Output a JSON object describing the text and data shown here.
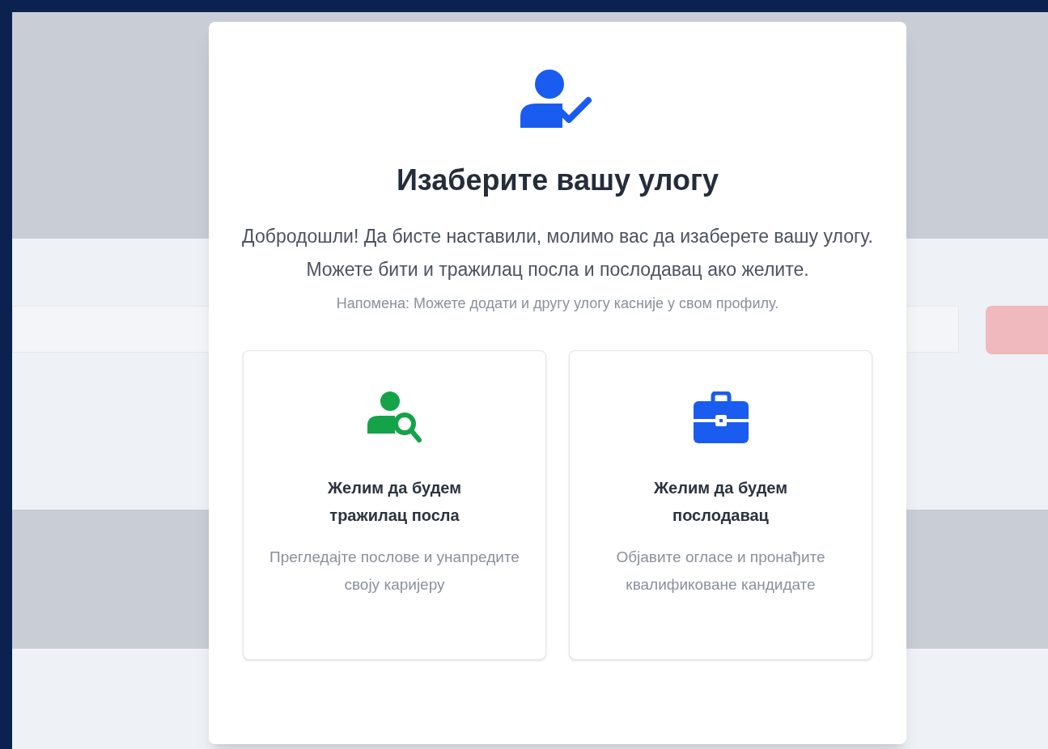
{
  "modal": {
    "title": "Изаберите вашу улогу",
    "message": "Добродошли! Да бисте наставили, молимо вас да изаберете вашу улогу. Можете бити и тражилац посла и послодавац ако желите.",
    "note": "Напомена: Можете додати и другу улогу касније у свом профилу.",
    "options": [
      {
        "kind": "job_seeker",
        "title": "Желим да будем тражилац посла",
        "description": "Прегледајте послове и унапредите своју каријеру"
      },
      {
        "kind": "employer",
        "title": "Желим да будем послодавац",
        "description": "Објавите огласе и пронађите квалификоване кандидате"
      }
    ]
  }
}
